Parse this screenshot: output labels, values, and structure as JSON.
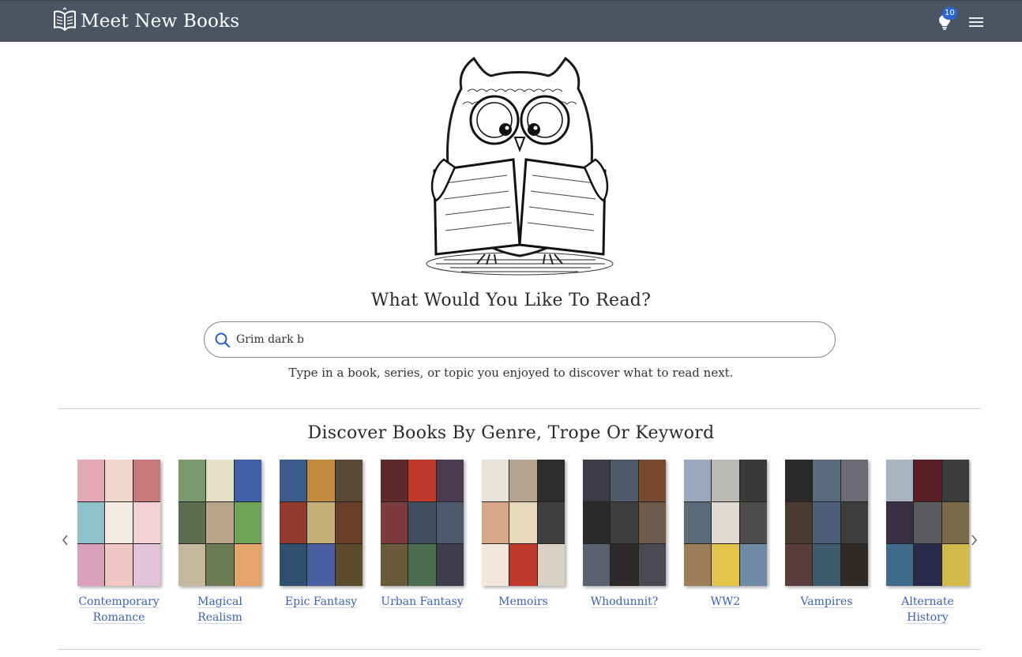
{
  "brand": {
    "name": "Meet New Books",
    "logo_icon": "book-logo-icon"
  },
  "nav": {
    "notifications_count": "10",
    "bulb_icon": "lightbulb-icon",
    "menu_icon": "hamburger-menu-icon"
  },
  "hero": {
    "image": "owl-reading-book-illustration",
    "title": "What Would You Like To Read?",
    "search_value": "Grim dark b",
    "search_icon": "search-icon",
    "subtitle": "Type in a book, series, or topic you enjoyed to discover what to read next."
  },
  "discover": {
    "title": "Discover Books By Genre, Trope Or Keyword",
    "genres": [
      {
        "label": "Contemporary Romance",
        "colors": [
          "#e3a8b7",
          "#f0d7c9",
          "#c87a7a",
          "#8fc1c8",
          "#f3ece4",
          "#f2d1d9",
          "#d9a0b8",
          "#f1c8c3",
          "#e2c2d9"
        ]
      },
      {
        "label": "Magical Realism",
        "colors": [
          "#7a9a6e",
          "#e6e0c9",
          "#3f5fa6",
          "#5c6c4f",
          "#b9a58a",
          "#6da45a",
          "#c4b79e",
          "#6b7b53",
          "#e4a46a"
        ]
      },
      {
        "label": "Epic Fantasy",
        "colors": [
          "#3b5b8a",
          "#c28a3c",
          "#5a4a36",
          "#8f3a2a",
          "#c6b079",
          "#6a3f2a",
          "#2f4f6f",
          "#4b5fa0",
          "#5d4b2c"
        ]
      },
      {
        "label": "Urban Fantasy",
        "colors": [
          "#5e2a2a",
          "#c0392b",
          "#4a3a52",
          "#7d3b3b",
          "#3f4f5f",
          "#4d5a6e",
          "#6b5a3a",
          "#4c6c4e",
          "#3d3d4e"
        ]
      },
      {
        "label": "Memoirs",
        "colors": [
          "#e7e2da",
          "#b5a58e",
          "#2d2d2d",
          "#d8a78a",
          "#e8d9bd",
          "#3f3f3f",
          "#f2e7da",
          "#c0392b",
          "#d9d2c4"
        ]
      },
      {
        "label": "Whodunnit?",
        "colors": [
          "#3c3c46",
          "#4b5b6b",
          "#7a4a2e",
          "#2a2a2a",
          "#3d3d3d",
          "#6e5a4a",
          "#5c6070",
          "#2e2a2a",
          "#4a4a52"
        ]
      },
      {
        "label": "WW2",
        "colors": [
          "#9aa9bd",
          "#b9b8b4",
          "#3a3a3a",
          "#5a6b7a",
          "#dfdbd2",
          "#4d4d4d",
          "#9c7d5a",
          "#e3c34a",
          "#6f8aa4"
        ]
      },
      {
        "label": "Vampires",
        "colors": [
          "#2a2a2a",
          "#5a6b7e",
          "#6b6b73",
          "#4a3a30",
          "#4e5f7a",
          "#3d3d3d",
          "#5a3c3c",
          "#3f5a6c",
          "#2e2a28"
        ]
      },
      {
        "label": "Alternate History",
        "colors": [
          "#a7b3bf",
          "#5a1f24",
          "#3b3b3b",
          "#3a3046",
          "#5c5c60",
          "#7a6a4a",
          "#3f6b8a",
          "#2c2a4a",
          "#d1b94a"
        ]
      }
    ]
  },
  "carousel": {
    "prev_icon": "chevron-left-icon",
    "next_icon": "chevron-right-icon"
  }
}
